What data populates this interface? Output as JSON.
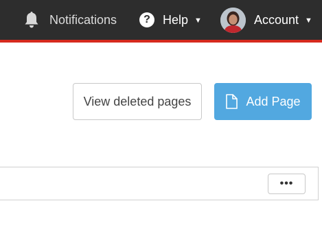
{
  "topbar": {
    "notifications": {
      "label": "Notifications",
      "icon": "bell-icon"
    },
    "help": {
      "label": "Help",
      "icon": "question-circle-icon",
      "caret": "▼"
    },
    "account": {
      "label": "Account",
      "icon": "avatar",
      "caret": "▼"
    }
  },
  "actions": {
    "view_deleted_label": "View deleted pages",
    "add_page_label": "Add Page",
    "add_page_icon": "document-icon"
  },
  "panel": {
    "more_label": "•••"
  },
  "colors": {
    "topbar_bg": "#2d2d2d",
    "accent_red": "#d62a1e",
    "primary_blue": "#52a8e0"
  }
}
